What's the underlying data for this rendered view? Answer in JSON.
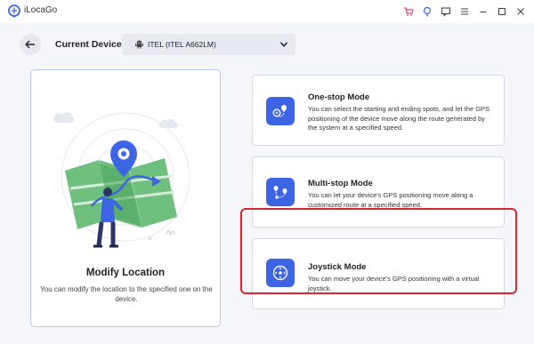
{
  "app": {
    "name": "iLocaGo"
  },
  "device_bar": {
    "label": "Current Device:",
    "selected_device": "ITEL (ITEL A662LM)"
  },
  "left_card": {
    "title": "Modify Location",
    "description": "You can modify the location to the specified one on the device."
  },
  "modes": [
    {
      "title": "One-stop Mode",
      "description": "You can select the starting and ending spots, and let the GPS positioning of the device move along the route generated by the system at a specified speed."
    },
    {
      "title": "Multi-stop Mode",
      "description": "You can let your device's GPS positioning move along a customized route at a specified speed."
    },
    {
      "title": "Joystick Mode",
      "description": "You can move your device's GPS positioning with a virtual joystick."
    }
  ],
  "colors": {
    "accent": "#3e64e6",
    "highlight": "#d7262f",
    "cart_icon": "#e0457b",
    "bulb_icon": "#3e64e6"
  }
}
